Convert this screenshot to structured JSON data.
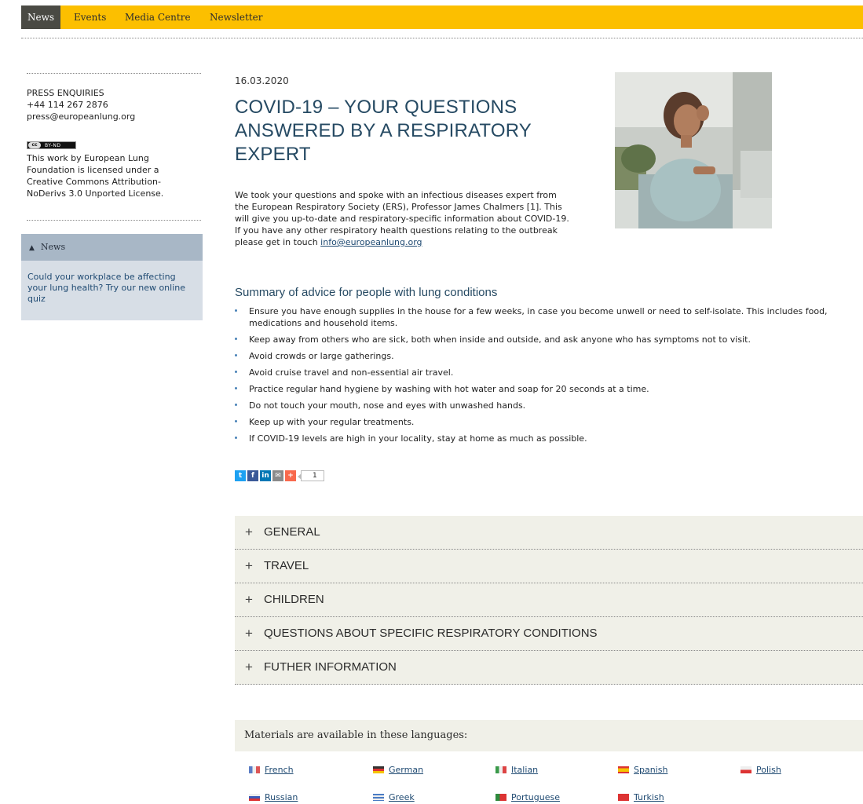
{
  "nav": {
    "items": [
      {
        "label": "News",
        "active": true
      },
      {
        "label": "Events",
        "active": false
      },
      {
        "label": "Media Centre",
        "active": false
      },
      {
        "label": "Newsletter",
        "active": false
      }
    ]
  },
  "sidebar": {
    "press_title": "PRESS ENQUIRIES",
    "press_phone": "+44 114 267 2876",
    "press_email": "press@europeanlung.org",
    "cc_badge_text": "BY-ND",
    "license_line1": "This work by European Lung",
    "license_line2": "Foundation is licensed under a",
    "license_link1": "Creative Commons Attribution-",
    "license_link2": "NoDerivs 3.0 Unported License.",
    "news_box_title": "News",
    "news_box_text": "Could your workplace be affecting your lung health? Try our new online quiz"
  },
  "article": {
    "date": "16.03.2020",
    "title": "COVID-19 – YOUR QUESTIONS ANSWERED BY A RESPIRATORY EXPERT",
    "intro": "We took your questions and spoke with an infectious diseases expert from the European Respiratory Society (ERS), Professor James Chalmers [1]. This will give you up-to-date and respiratory-specific information about COVID-19. If you have any other respiratory health questions relating to the outbreak please get in touch",
    "intro_link": "info@europeanlung.org",
    "summary_title": "Summary of advice for people with lung conditions",
    "advice": [
      "Ensure you have enough supplies in the house for a few weeks, in case you become unwell or need to self-isolate. This includes food, medications and household items.",
      "Keep away from others who are sick, both when inside and outside, and ask anyone who has symptoms not to visit.",
      "Avoid crowds or large gatherings.",
      "Avoid cruise travel and non-essential air travel.",
      "Practice regular hand hygiene by washing with hot water and soap for 20 seconds at a time.",
      "Do not touch your mouth, nose and eyes with unwashed hands.",
      "Keep up with your regular treatments.",
      "If COVID-19 levels are high in your locality, stay at home as much as possible."
    ]
  },
  "share": {
    "buttons": [
      {
        "icon": "twitter-icon",
        "glyph": "t",
        "color": "#1da1f2"
      },
      {
        "icon": "facebook-icon",
        "glyph": "f",
        "color": "#3b5998"
      },
      {
        "icon": "linkedin-icon",
        "glyph": "in",
        "color": "#0077b5"
      },
      {
        "icon": "email-icon",
        "glyph": "✉",
        "color": "#8a8a8a"
      },
      {
        "icon": "addthis-icon",
        "glyph": "+",
        "color": "#f8694d"
      }
    ],
    "count": "1"
  },
  "accordion": {
    "items": [
      "GENERAL",
      "TRAVEL",
      "CHILDREN",
      "QUESTIONS ABOUT SPECIFIC RESPIRATORY CONDITIONS",
      "FUTHER INFORMATION"
    ]
  },
  "languages": {
    "heading": "Materials are available in these languages:",
    "items": [
      "French",
      "German",
      "Italian",
      "Spanish",
      "Polish",
      "Russian",
      "Greek",
      "Portuguese",
      "Turkish"
    ]
  },
  "colors": {
    "nav_bar": "#fcbf00",
    "nav_active": "#4a4a44",
    "title": "#264a63",
    "link": "#1f4a72"
  }
}
